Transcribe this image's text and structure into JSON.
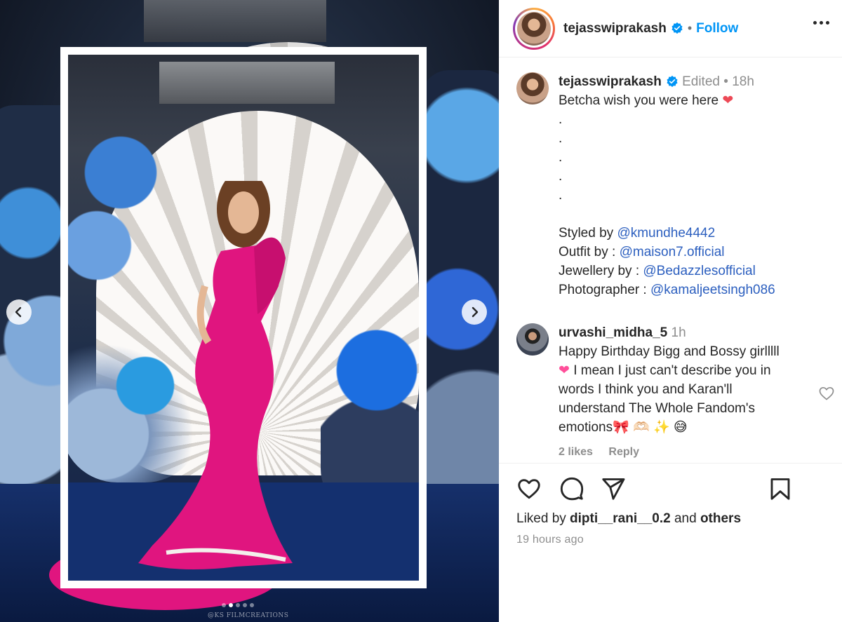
{
  "post": {
    "username": "tejasswiprakash",
    "follow_label": "Follow",
    "separator": "•",
    "watermark": "@KS FILMCREATIONS",
    "slide_count": 5,
    "active_slide": 2
  },
  "caption": {
    "username": "tejasswiprakash",
    "edited": "Edited",
    "dot": "•",
    "time": "18h",
    "text": "Betcha wish you were here",
    "dots": [
      ".",
      ".",
      ".",
      ".",
      "."
    ],
    "credits": [
      {
        "label": "Styled by ",
        "mention": "@kmundhe4442"
      },
      {
        "label": "Outfit by : ",
        "mention": "@maison7.official"
      },
      {
        "label": "Jewellery by : ",
        "mention": "@Bedazzlesofficial"
      },
      {
        "label": "Photographer : ",
        "mention": "@kamaljeetsingh086"
      }
    ]
  },
  "reply": {
    "username": "urvashi_midha_5",
    "time": "1h",
    "lines": [
      "Happy Birthday Bigg and Bossy girlllll",
      "I mean I just can't describe you in",
      "words I think you and Karan'll",
      "understand The Whole Fandom's",
      "emotions"
    ],
    "emoji_tail": "🎀 🫶🏻 ✨ 😅",
    "likes": "2 likes",
    "reply_label": "Reply"
  },
  "footer": {
    "liked_by_prefix": "Liked by ",
    "liked_by_user": "dipti__rani__0.2",
    "liked_by_mid": " and ",
    "liked_by_others": "others",
    "timestamp": "19 hours ago"
  },
  "colors": {
    "accent": "#0095f6",
    "mention": "#2c5fbf",
    "gown": "#e0157f",
    "heart": "#ed4956"
  }
}
